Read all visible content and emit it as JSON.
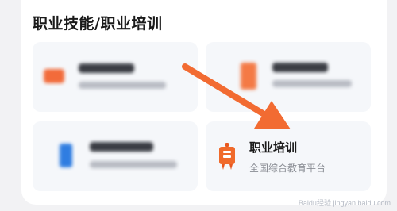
{
  "section": {
    "title": "职业技能/职业培训"
  },
  "cards": [
    {
      "icon": "blurred-orange-icon",
      "state": "blurred"
    },
    {
      "icon": "blurred-orange-icon",
      "state": "blurred"
    },
    {
      "icon": "blurred-blue-icon",
      "state": "blurred"
    },
    {
      "icon": "training-icon",
      "title": "职业培训",
      "subtitle": "全国综合教育平台"
    }
  ],
  "watermark": {
    "text": "Baidu经验 jingyan.baidu.com"
  },
  "colors": {
    "accent_orange": "#f06a2b",
    "arrow": "#f26b32",
    "card_bg": "#f5f7fa",
    "page_bg": "#f2f2f4"
  }
}
